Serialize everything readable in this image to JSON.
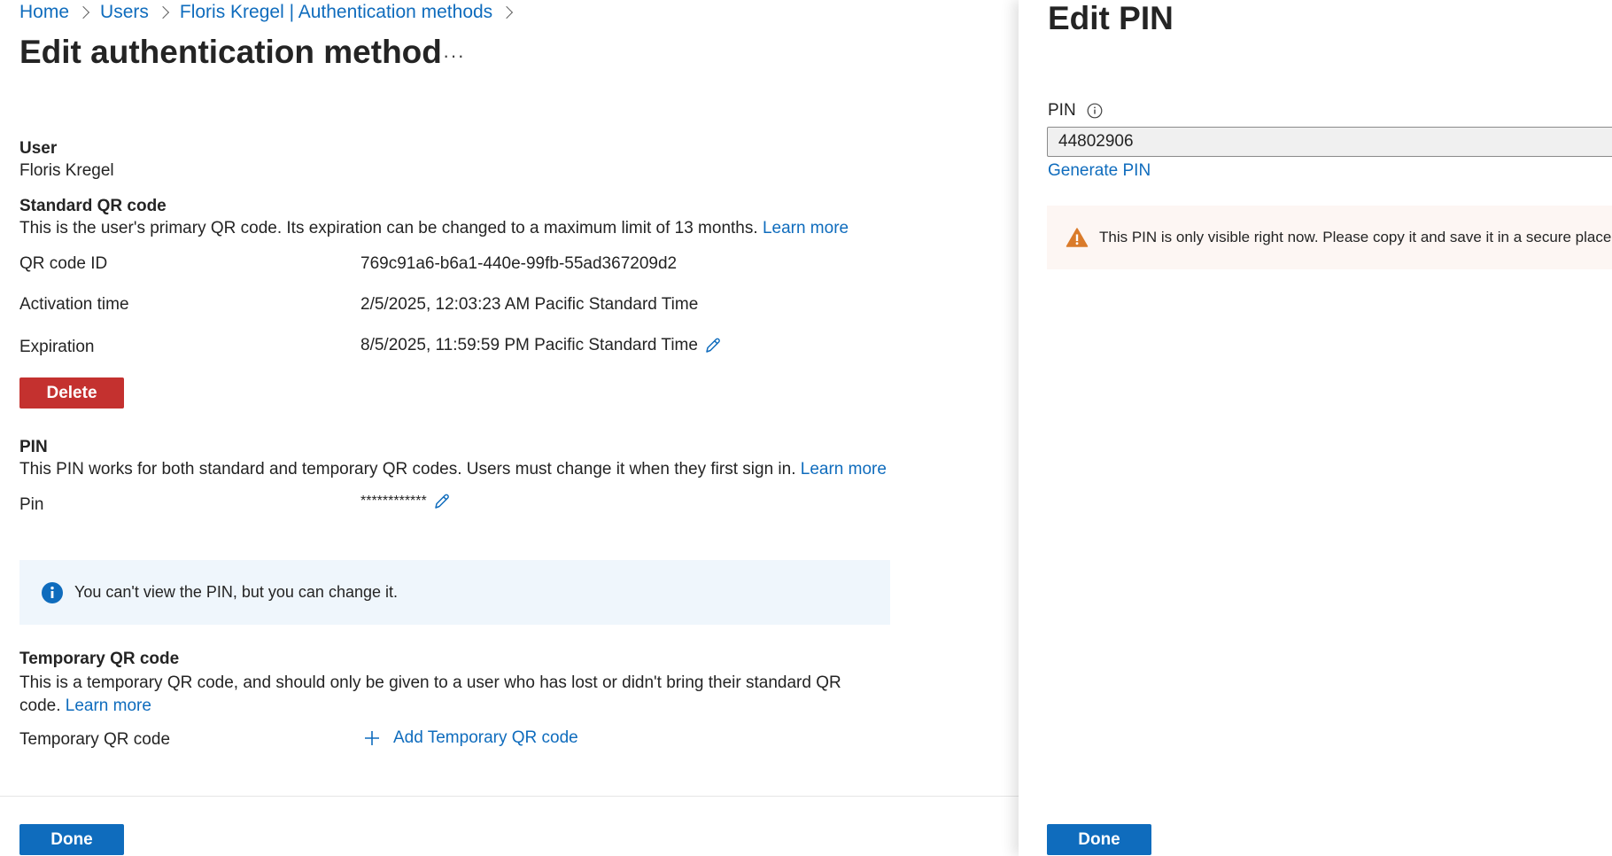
{
  "breadcrumb": {
    "items": [
      "Home",
      "Users",
      "Floris Kregel | Authentication methods"
    ]
  },
  "page": {
    "title": "Edit authentication method",
    "more": "···"
  },
  "user": {
    "heading": "User",
    "name": "Floris Kregel"
  },
  "standard_qr": {
    "heading": "Standard QR code",
    "description": "This is the user's primary QR code. Its expiration can be changed to a maximum limit of 13 months.",
    "learn_more": "Learn more",
    "rows": [
      {
        "label": "QR code ID",
        "value": "769c91a6-b6a1-440e-99fb-55ad367209d2"
      },
      {
        "label": "Activation time",
        "value": "2/5/2025, 12:03:23 AM Pacific Standard Time"
      },
      {
        "label": "Expiration",
        "value": "8/5/2025, 11:59:59 PM Pacific Standard Time"
      }
    ],
    "delete_label": "Delete"
  },
  "pin": {
    "heading": "PIN",
    "description": "This PIN works for both standard and temporary QR codes. Users must change it when they first sign in.",
    "learn_more": "Learn more",
    "row_label": "Pin",
    "row_value": "************",
    "info_message": "You can't view the PIN, but you can change it."
  },
  "temporary_qr": {
    "heading": "Temporary QR code",
    "description": "This is a temporary QR code, and should only be given to a user who has lost or didn't bring their standard QR code.",
    "learn_more": "Learn more",
    "row_label": "Temporary QR code",
    "add_label": "Add Temporary QR code"
  },
  "footer": {
    "done_label": "Done"
  },
  "panel": {
    "title": "Edit PIN",
    "pin_label": "PIN",
    "pin_value": "44802906",
    "generate_label": "Generate PIN",
    "warning_message": "This PIN is only visible right now. Please copy it and save it in a secure place.",
    "done_label": "Done"
  },
  "colors": {
    "accent": "#0f6cbd",
    "danger": "#c4312f",
    "warning": "#da7b2a",
    "info_bg": "#eff6fc"
  }
}
